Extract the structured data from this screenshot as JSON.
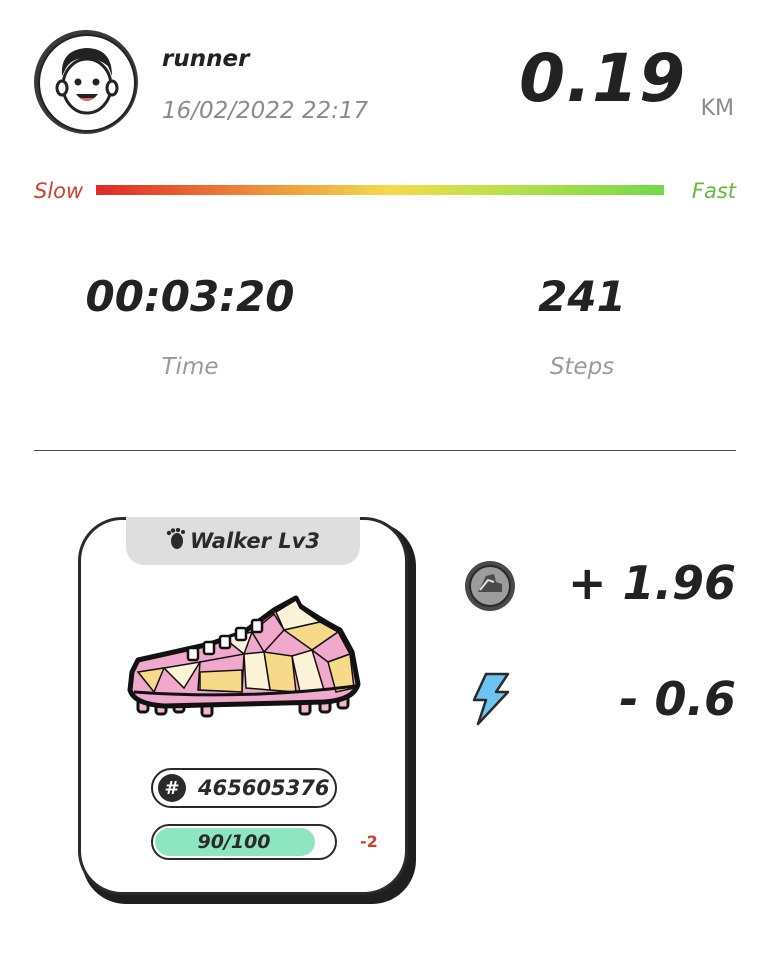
{
  "user": {
    "name": "runner",
    "datetime": "16/02/2022 22:17",
    "avatar_icon": "cartoon-face-avatar"
  },
  "distance": {
    "value": "0.19",
    "unit": "KM"
  },
  "speed_bar": {
    "slow_label": "Slow",
    "fast_label": "Fast",
    "colors": [
      "#dd2a26",
      "#ef8a3a",
      "#f2dc4c",
      "#b9e04a",
      "#73d94a"
    ]
  },
  "stats": [
    {
      "value": "00:03:20",
      "label": "Time"
    },
    {
      "value": "241",
      "label": "Steps"
    }
  ],
  "shoe_card": {
    "type_icon": "footprint-icon",
    "type_label": "Walker Lv3",
    "id_icon": "hash-icon",
    "id": "465605376",
    "durability_text": "90/100",
    "durability_fraction": 0.9,
    "durability_color": "#8ee6c0",
    "durability_change": "-2"
  },
  "rewards": [
    {
      "icon": "gst-coin-icon",
      "value": "+ 1.96"
    },
    {
      "icon": "energy-bolt-icon",
      "value": "- 0.6",
      "icon_color": "#6cc4f0"
    }
  ]
}
